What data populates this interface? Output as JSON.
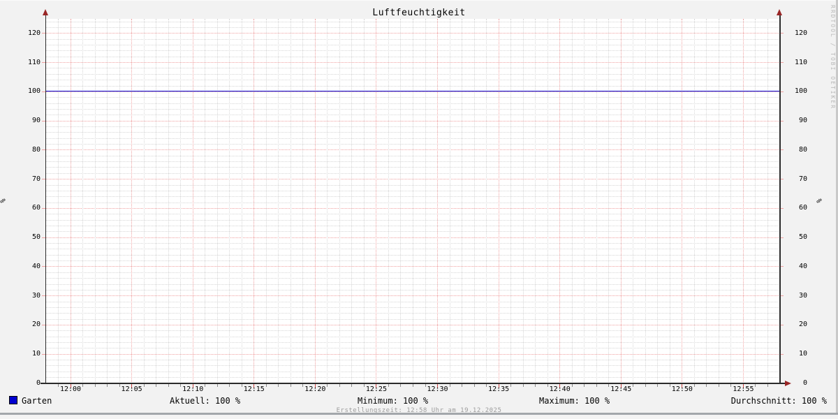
{
  "watermark": "RRDTOOL / TOBI OETIKER",
  "footer": {
    "creation_time": "Erstellungszeit: 12:58 Uhr am 19.12.2025"
  },
  "legend": {
    "series_label": "Garten",
    "stats": {
      "aktuell": "Aktuell: 100 %",
      "minimum": "Minimum: 100 %",
      "maximum": "Maximum: 100 %",
      "durchschnitt": "Durchschnitt: 100 %"
    }
  },
  "chart_data": {
    "type": "line",
    "title": "Luftfeuchtigkeit",
    "xlabel": "",
    "ylabel": "%",
    "ylim": [
      0,
      125
    ],
    "y_major_step": 10,
    "y_minor_step": 2,
    "y_major_ticks": [
      0,
      10,
      20,
      30,
      40,
      50,
      60,
      70,
      80,
      90,
      100,
      110,
      120
    ],
    "x_range": [
      "11:58",
      "12:58"
    ],
    "x_major_step_minutes": 5,
    "x_minor_step_minutes": 1,
    "x_major_ticks": [
      "12:00",
      "12:05",
      "12:10",
      "12:15",
      "12:20",
      "12:25",
      "12:30",
      "12:35",
      "12:40",
      "12:45",
      "12:50",
      "12:55"
    ],
    "grid": true,
    "legend_position": "bottom",
    "series": [
      {
        "name": "Garten",
        "color": "#0000cc",
        "x": [
          "11:58",
          "12:58"
        ],
        "y": [
          100,
          100
        ]
      }
    ],
    "stats": {
      "aktuell": 100,
      "minimum": 100,
      "maximum": 100,
      "durchschnitt": 100,
      "unit": "%"
    },
    "colors": {
      "background": "#f2f2f2",
      "canvas": "#ffffff",
      "grid_minor": "#d6d6d6",
      "grid_major": "#f0a0a0",
      "tick_minor": "#8a8a8a",
      "tick_major": "#cc4444",
      "axis": "#2b2b2b",
      "arrow": "#992626"
    }
  }
}
